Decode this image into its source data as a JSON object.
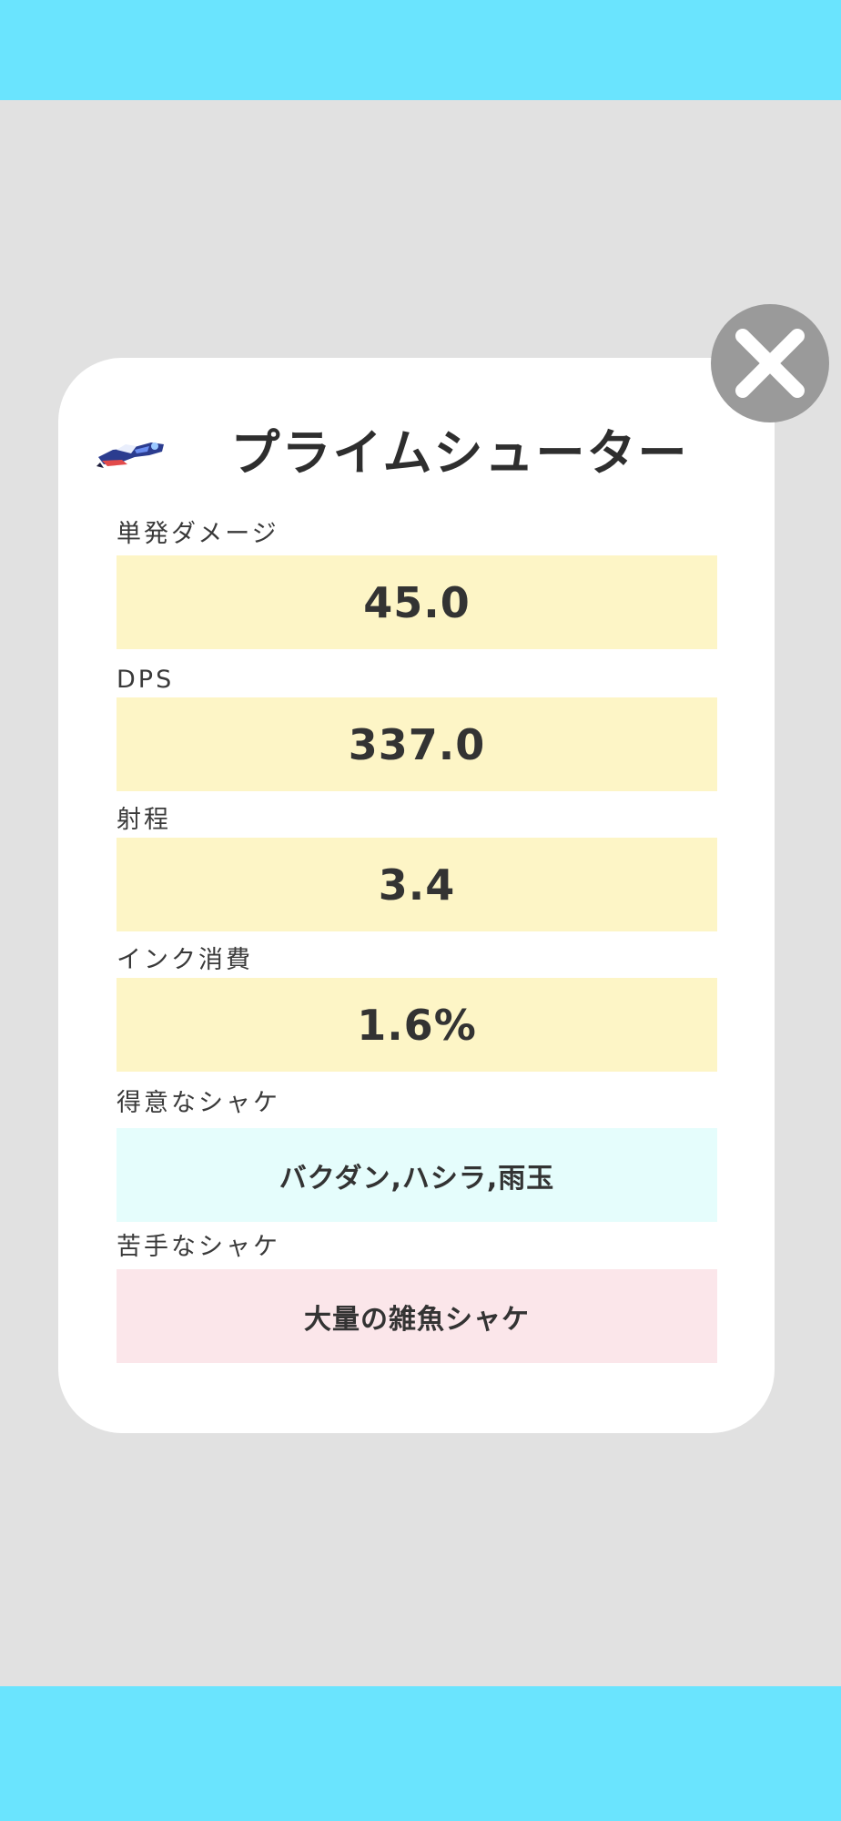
{
  "weapon": {
    "name": "プライムシューター",
    "icon": "prime-shooter-weapon-icon"
  },
  "stats": [
    {
      "label": "単発ダメージ",
      "value": "45.0"
    },
    {
      "label": "DPS",
      "value": "337.0"
    },
    {
      "label": "射程",
      "value": "3.4"
    },
    {
      "label": "インク消費",
      "value": "1.6%"
    }
  ],
  "strong_against": {
    "label": "得意なシャケ",
    "value": "バクダン,ハシラ,雨玉"
  },
  "weak_against": {
    "label": "苦手なシャケ",
    "value": "大量の雑魚シャケ"
  },
  "close_button": {
    "icon": "close-icon"
  },
  "colors": {
    "header_bar": "#6ae4fe",
    "background": "#e1e1e1",
    "card": "#ffffff",
    "stat_box": "#fdf5c6",
    "strong_box": "#e5fdfc",
    "weak_box": "#fbe6ea",
    "close_button": "#9a9a9a"
  }
}
